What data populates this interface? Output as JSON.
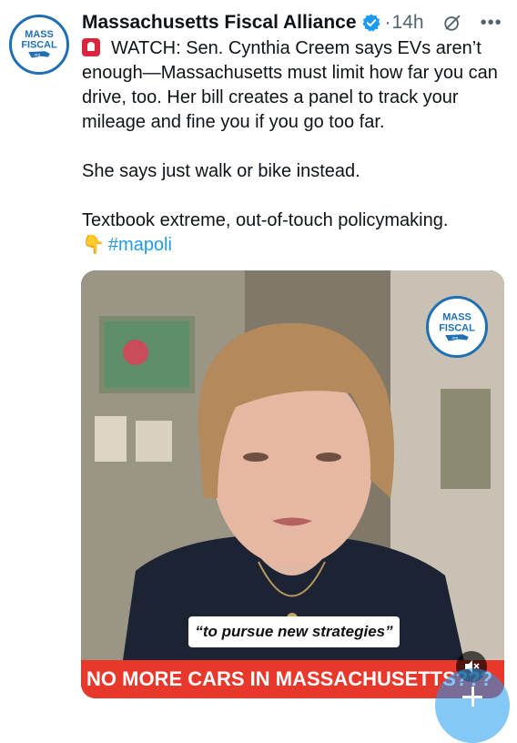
{
  "post": {
    "author": "Massachusetts Fiscal Alliance",
    "time": "14h",
    "separator": "·",
    "icons": {
      "avatar": "mass-fiscal-logo",
      "verified": "verified-badge-icon",
      "grok": "grok-icon",
      "more": "more-options-icon",
      "alert": "siren-emoji",
      "pointer": "backhand-index-pointing-down-emoji"
    }
  },
  "tweet": {
    "line1": "WATCH: Sen. Cynthia Creem says EVs aren’t enough—Massachusetts must limit how far you can drive, too. Her bill creates a panel to track your mileage and fine you if you go too far.",
    "line2": "She says just walk or bike instead.",
    "line3": "Textbook extreme, out-of-touch policymaking.",
    "hashtag": "#mapoli"
  },
  "media": {
    "logo_text_top": "MASS",
    "logo_text_bottom": "FISCAL",
    "logo_org": ".org",
    "caption": "“to pursue new strategies”",
    "banner": "NO MORE CARS IN MASSACHUSETTS???"
  },
  "colors": {
    "link": "#1d9bf0",
    "banner": "#e8372b",
    "brand": "#1f6fb6"
  }
}
